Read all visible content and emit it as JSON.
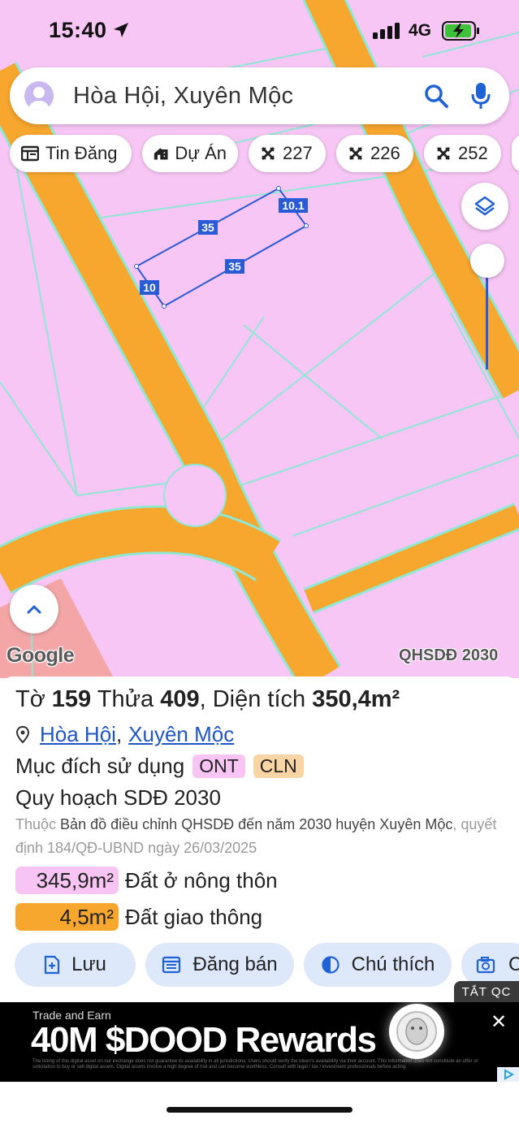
{
  "status": {
    "time": "15:40",
    "network": "4G",
    "location_icon": "location-arrow-icon",
    "signal_icon": "signal-bars-icon",
    "battery_icon": "battery-charging-icon"
  },
  "search": {
    "query": "Hòa Hội, Xuyên Mộc",
    "avatar_icon": "user-avatar-icon",
    "search_icon": "search-icon",
    "mic_icon": "microphone-icon"
  },
  "chips": [
    {
      "label": "Tin Đăng",
      "icon": "listing-icon"
    },
    {
      "label": "Dự Án",
      "icon": "building-icon"
    },
    {
      "label": "227",
      "icon": "pattern-icon"
    },
    {
      "label": "226",
      "icon": "pattern-icon"
    },
    {
      "label": "252",
      "icon": "pattern-icon"
    }
  ],
  "map": {
    "edge_labels": [
      "35",
      "10.1",
      "35",
      "10"
    ],
    "google": "Google",
    "layer_label": "QHSDĐ 2030",
    "colors": {
      "residential": "#f7c6f4",
      "road": "#f7a62e",
      "boundary": "#8ee8d4",
      "parcel": "#2a5bd6",
      "other_land": "#f4a6a6"
    }
  },
  "panel": {
    "title_prefix": "Tờ",
    "sheet": "159",
    "title_mid": "Thửa",
    "parcel": "409",
    "title_area_label": ", Diện tích",
    "area": "350,4m²",
    "commune": "Hòa Hội",
    "district": "Xuyên Mộc",
    "purpose_label": "Mục đích sử dụng",
    "purpose_tags": [
      "ONT",
      "CLN"
    ],
    "plan_label": "Quy hoạch SDĐ 2030",
    "source_prefix": "Thuộc",
    "source_map": "Bản đồ điều chỉnh QHSDĐ đến năm 2030 huyện Xuyên Mộc",
    "source_decision": ", quyết định 184/QĐ-UBND ngày 26/03/2025",
    "areas": [
      {
        "value": "345,9m²",
        "label": "Đất ở nông thôn",
        "color": "#f7c4f4"
      },
      {
        "value": "4,5m²",
        "label": "Đất giao thông",
        "color": "#f7a62e"
      }
    ],
    "actions": [
      {
        "label": "Lưu",
        "icon": "save-file-icon"
      },
      {
        "label": "Đăng bán",
        "icon": "calendar-list-icon"
      },
      {
        "label": "Chú thích",
        "icon": "half-circle-icon"
      },
      {
        "label": "C",
        "icon": "camera-icon"
      }
    ]
  },
  "ad": {
    "close_label": "TẮT QC",
    "small": "Trade and Earn",
    "headline": "40M $DOOD Rewards",
    "fine_print": "The listing of this digital asset on our exchange does not guarantee its availability in all jurisdictions. Users should verify the token's availability via their account. This information does not constitute an offer or solicitation to buy or sell digital assets. Digital assets involve a high degree of risk and can become worthless. Consult with legal / tax / investment professionals before acting."
  }
}
